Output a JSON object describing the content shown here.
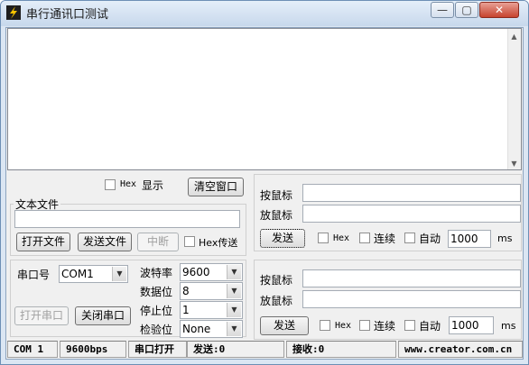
{
  "window": {
    "title": "串行通讯口测试",
    "minimize_glyph": "—",
    "maximize_glyph": "▢",
    "close_glyph": "✕"
  },
  "receive": {
    "hex_label": "Hex",
    "display_label": "显示",
    "clear_button": "清空窗口"
  },
  "text_file": {
    "legend": "文本文件",
    "path_value": "",
    "open_button": "打开文件",
    "send_button": "发送文件",
    "stop_button": "中断",
    "hex_transfer_label": "Hex传送"
  },
  "serial": {
    "port_label": "串口号",
    "port_value": "COM1",
    "baud_label": "波特率",
    "baud_value": "9600",
    "data_bits_label": "数据位",
    "data_bits_value": "8",
    "stop_bits_label": "停止位",
    "stop_bits_value": "1",
    "parity_label": "检验位",
    "parity_value": "None",
    "open_port_button": "打开串口",
    "close_port_button": "关闭串口"
  },
  "send_panel_1": {
    "press_label": "按鼠标",
    "release_label": "放鼠标",
    "press_value": "",
    "release_value": "",
    "send_button": "发送",
    "hex_label": "Hex",
    "continuous_label": "连续",
    "auto_label": "自动",
    "interval_value": "1000",
    "unit": "ms"
  },
  "send_panel_2": {
    "press_label": "按鼠标",
    "release_label": "放鼠标",
    "press_value": "",
    "release_value": "",
    "send_button": "发送",
    "hex_label": "Hex",
    "continuous_label": "连续",
    "auto_label": "自动",
    "interval_value": "1000",
    "unit": "ms"
  },
  "status": {
    "port": "COM 1",
    "baud": "9600bps",
    "state": "串口打开",
    "sent": "发送:0",
    "received": "接收:0",
    "website": "www.creator.com.cn"
  },
  "colors": {
    "title_bar": "#c7d8ec",
    "close_button": "#c7432e",
    "panel": "#f0f0f0"
  }
}
